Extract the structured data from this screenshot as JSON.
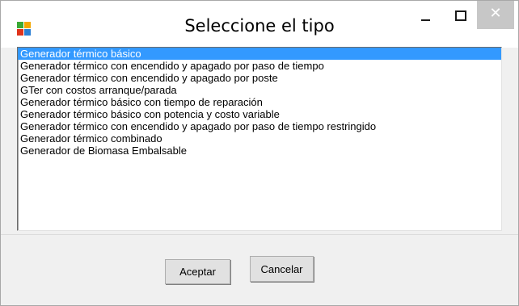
{
  "window": {
    "title": "Seleccione el tipo",
    "icon": "app-tiles-icon",
    "icon_colors": [
      "#3aa935",
      "#f2a700",
      "#e0331b",
      "#2a7fd4"
    ],
    "close_button_color": "#c7c7c7"
  },
  "list": {
    "selected_index": 0,
    "selection_color": "#3399ff",
    "items": [
      "Generador térmico básico",
      "Generador térmico con encendido y apagado por paso de tiempo",
      "Generador térmico con encendido y apagado por poste",
      "GTer con costos arranque/parada",
      "Generador térmico básico con tiempo de reparación",
      "Generador térmico básico con potencia y costo variable",
      "Generador térmico con encendido y apagado por paso de tiempo restringido",
      "Generador térmico combinado",
      "Generador de Biomasa Embalsable"
    ]
  },
  "buttons": {
    "accept": "Aceptar",
    "cancel": "Cancelar"
  }
}
